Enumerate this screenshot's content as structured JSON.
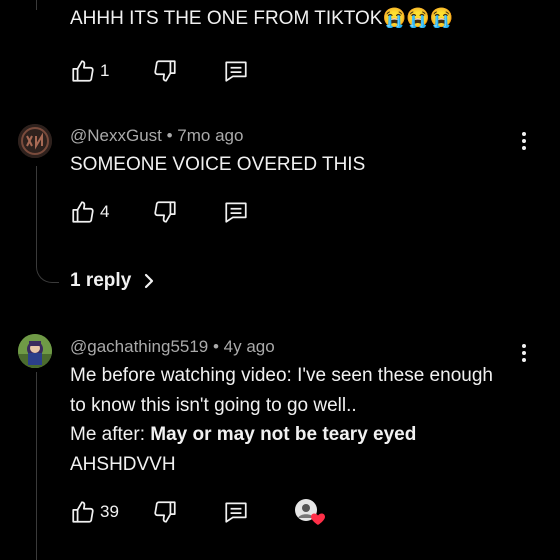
{
  "comments": [
    {
      "text": "AHHH ITS THE ONE FROM TIKTOK",
      "emoji": "😭😭😭",
      "likes": "1"
    },
    {
      "author": "@NexxGust",
      "time": "7mo ago",
      "text": "SOMEONE VOICE OVERED THIS",
      "likes": "4",
      "replies": "1 reply"
    },
    {
      "author": "@gachathing5519",
      "time": "4y ago",
      "line1": "Me before watching video: I've seen these enough",
      "line2": "to know this isn't going to go well..",
      "line3_prefix": "Me after: ",
      "line3_bold": "May or may not be teary eyed",
      "line4": "AHSHDVVH",
      "likes": "39"
    }
  ],
  "separator": " • "
}
